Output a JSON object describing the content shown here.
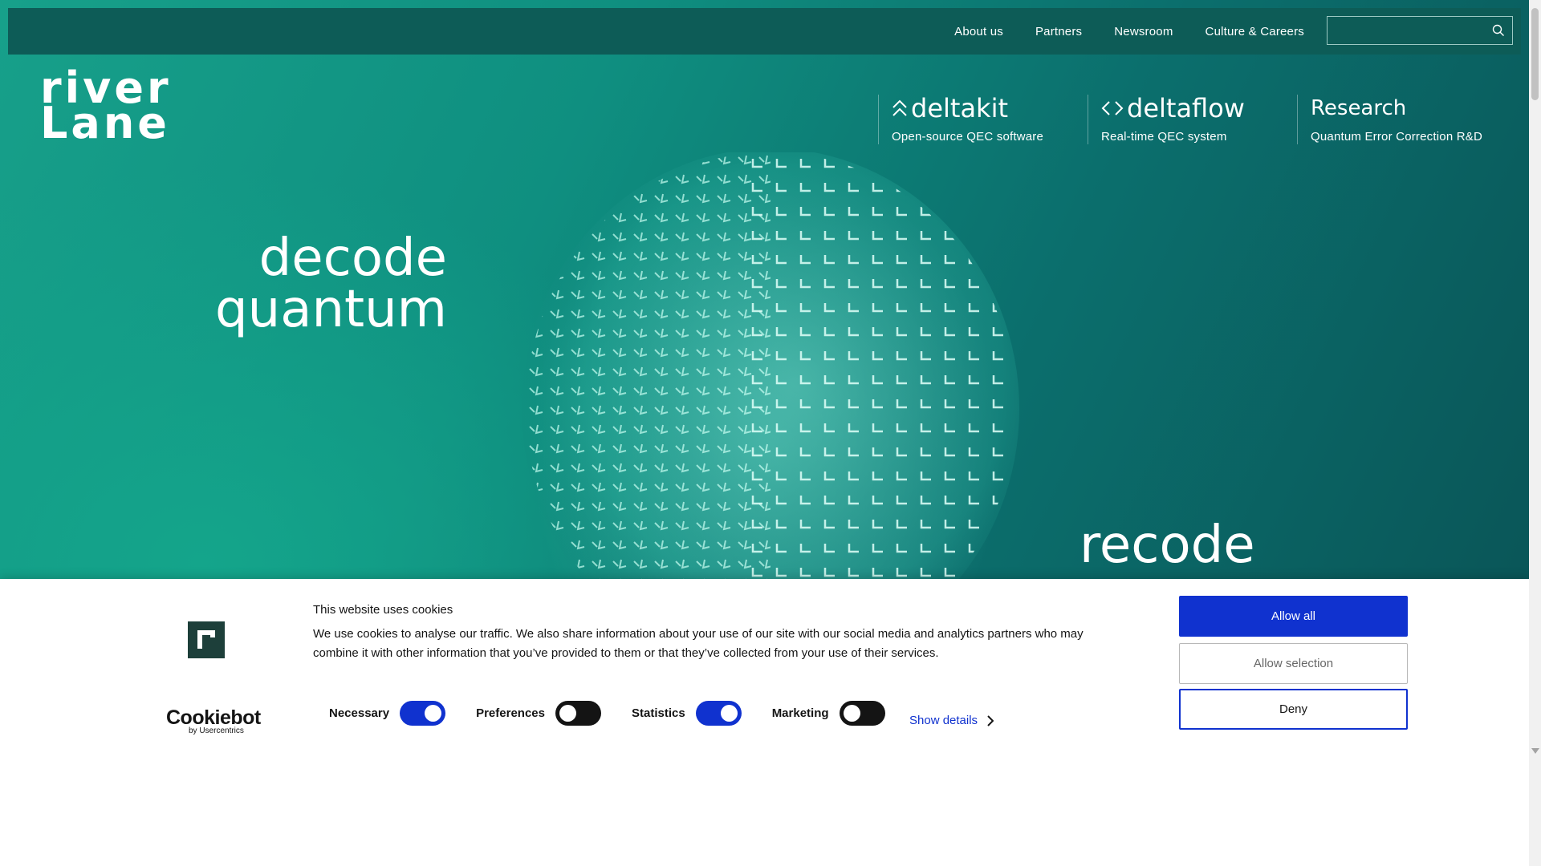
{
  "nav": {
    "items": [
      "About us",
      "Partners",
      "Newsroom",
      "Culture & Careers"
    ],
    "search_placeholder": ""
  },
  "logo": {
    "line1": "river",
    "line2": "Lane"
  },
  "products": [
    {
      "name": "deltakit",
      "desc": "Open-source QEC software"
    },
    {
      "name": "deltaflow",
      "desc": "Real-time QEC system"
    },
    {
      "name": "Research",
      "desc": "Quantum Error Correction R&D"
    }
  ],
  "hero": {
    "left_line1": "decode",
    "left_line2": "quantum",
    "right_line1": "recode"
  },
  "cookie": {
    "title": "This website uses cookies",
    "text": "We use cookies to analyse our traffic. We also share information about your use of our site with our social media and analytics partners who may combine it with other information that you’ve provided to them or that they’ve collected from your use of their services.",
    "brand_main": "Cookiebot",
    "brand_sub": "by Usercentrics",
    "toggles": [
      {
        "label": "Necessary",
        "on": true
      },
      {
        "label": "Preferences",
        "on": false
      },
      {
        "label": "Statistics",
        "on": true
      },
      {
        "label": "Marketing",
        "on": false
      }
    ],
    "show_details": "Show details",
    "allow_all": "Allow all",
    "allow_selection": "Allow selection",
    "deny": "Deny",
    "accent_color": "#1032cf"
  }
}
